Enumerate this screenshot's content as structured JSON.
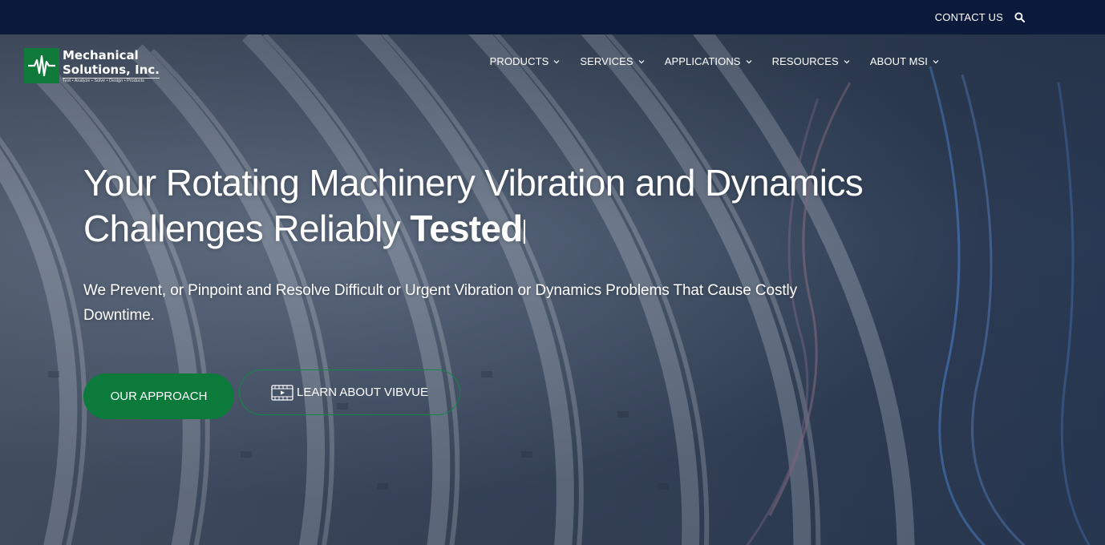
{
  "topbar": {
    "contact_label": "CONTACT US",
    "search_icon": "search-icon"
  },
  "logo": {
    "name_line1": "Mechanical",
    "name_line2": "Solutions, Inc.",
    "tagline": "Test • Analyze • Solve • Design • Products",
    "brand_color": "#0f7a3a"
  },
  "nav": {
    "items": [
      {
        "label": "PRODUCTS"
      },
      {
        "label": "SERVICES"
      },
      {
        "label": "APPLICATIONS"
      },
      {
        "label": "RESOURCES"
      },
      {
        "label": "ABOUT MSI"
      }
    ]
  },
  "hero": {
    "headline_line1": "Your Rotating Machinery Vibration and Dynamics",
    "headline_line2_prefix": "Challenges Reliably ",
    "headline_emphasis": "Tested",
    "subheadline": "We Prevent, or Pinpoint and Resolve Difficult or Urgent Vibration or Dynamics Problems That Cause Costly Downtime.",
    "primary_button": "OUR APPROACH",
    "secondary_button": "LEARN ABOUT VIBVUE",
    "secondary_button_icon": "video-icon"
  },
  "colors": {
    "topbar_bg": "#0b1a3b",
    "accent_green": "#0c7a3b",
    "outline_green": "#0e8a44"
  }
}
